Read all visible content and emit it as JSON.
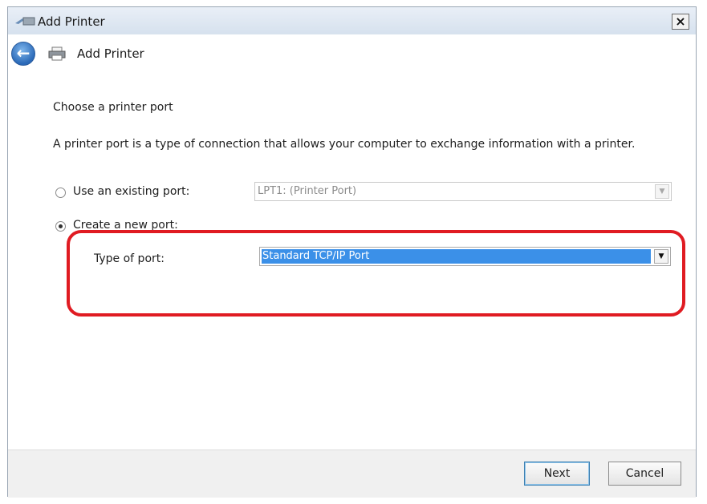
{
  "window": {
    "title": "Add Printer",
    "close_label": "×"
  },
  "nav": {
    "back_icon": "back-arrow-icon",
    "title": "Add Printer"
  },
  "page": {
    "heading": "Choose a printer port",
    "description": "A printer port is a type of connection that allows your computer to exchange information with a printer."
  },
  "options": {
    "existing_port": {
      "label": "Use an existing port:",
      "selected": false,
      "value": "LPT1: (Printer Port)",
      "enabled": false
    },
    "new_port": {
      "label": "Create a new port:",
      "selected": true,
      "type_label": "Type of port:",
      "value": "Standard TCP/IP Port",
      "enabled": true
    }
  },
  "annotation": {
    "color": "#e01b22"
  },
  "footer": {
    "next_label": "Next",
    "cancel_label": "Cancel"
  }
}
